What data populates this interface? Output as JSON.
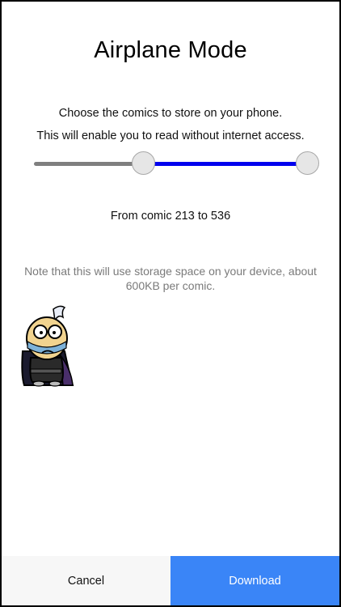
{
  "screen": {
    "title": "Airplane Mode",
    "description_line1": "Choose the comics to store on your phone.",
    "description_line2": "This will enable you to read without internet access."
  },
  "range_slider": {
    "selected_min": 213,
    "selected_max": 536,
    "colors": {
      "inactive_track": "#7f7f7f",
      "active_track": "#0000ee",
      "thumb": "#e6e6e6"
    }
  },
  "range_label": "From comic 213 to 536",
  "storage_note": "Note that this will use storage space on your device, about 600KB per comic.",
  "mascot": {
    "icon": "sad-comic-character-icon"
  },
  "actions": {
    "cancel_label": "Cancel",
    "download_label": "Download",
    "download_color": "#3a85f7"
  }
}
